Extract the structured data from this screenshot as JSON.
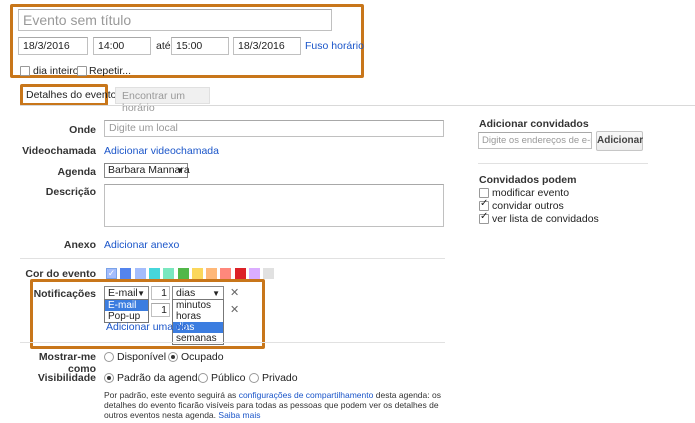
{
  "header": {
    "title_placeholder": "Evento sem título",
    "start_date": "18/3/2016",
    "start_time": "14:00",
    "until": "até",
    "end_time": "15:00",
    "end_date": "18/3/2016",
    "timezone_link": "Fuso horário",
    "all_day_label": "dia inteiro",
    "repeat_label": "Repetir..."
  },
  "tabs": [
    {
      "label": "Detalhes do evento",
      "selected": true
    },
    {
      "label": "Encontrar um horário",
      "selected": false
    }
  ],
  "form": {
    "where_label": "Onde",
    "where_placeholder": "Digite um local",
    "video_label": "Videochamada",
    "video_link": "Adicionar videochamada",
    "calendar_label": "Agenda",
    "calendar_value": "Barbara Mannara",
    "description_label": "Descrição",
    "attachment_label": "Anexo",
    "attachment_link": "Adicionar anexo",
    "color_label": "Cor do evento",
    "colors": [
      "#a4bdfc",
      "#5484ed",
      "#a4bdfc",
      "#46d6db",
      "#7ae7bf",
      "#51b749",
      "#fbd75b",
      "#ffb878",
      "#ff887c",
      "#dc2127",
      "#dbadff",
      "#e1e1e1"
    ],
    "notifications_label": "Notificações",
    "notif_method": "E-mail",
    "notif_method_options": [
      "E-mail",
      "Pop-up"
    ],
    "notif_amount": "1",
    "notif_unit": "dias",
    "notif_unit_options": [
      "minutos",
      "horas",
      "dias",
      "semanas"
    ],
    "add_notif_link": "Adicionar uma no",
    "show_me_label": "Mostrar-me como",
    "available_label": "Disponível",
    "busy_label": "Ocupado",
    "visibility_label": "Visibilidade",
    "vis_default": "Padrão da agenda",
    "vis_public": "Público",
    "vis_private": "Privado",
    "footnote_1": "Por padrão, este evento seguirá as",
    "footnote_link": "configurações de compartilhamento",
    "footnote_2": "desta agenda: os detalhes do",
    "footnote_3": "evento ficarão visíveis para todas as pessoas que podem ver os detalhes de outros eventos nesta",
    "footnote_4": "agenda.",
    "footnote_more": "Saiba mais"
  },
  "guests": {
    "title": "Adicionar convidados",
    "input_placeholder": "Digite os endereços de e-m",
    "add_button": "Adicionar",
    "can_title": "Convidados podem",
    "perm_modify": "modificar evento",
    "perm_invite": "convidar outros",
    "perm_list": "ver lista de convidados"
  }
}
